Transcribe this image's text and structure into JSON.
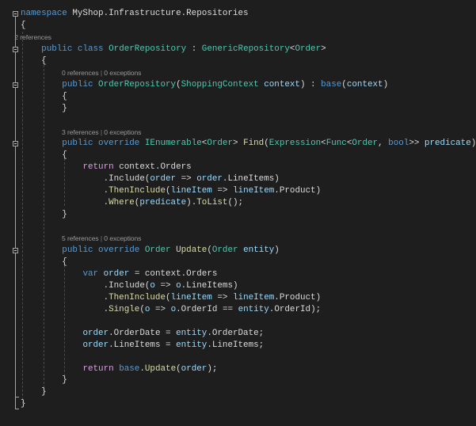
{
  "code": {
    "lines": [
      {
        "tokens": [
          {
            "c": "kw",
            "t": "namespace"
          },
          {
            "c": "df",
            "t": " MyShop.Infrastructure.Repositories"
          }
        ]
      },
      {
        "tokens": [
          {
            "c": "df",
            "t": "{"
          }
        ]
      },
      {
        "lens": true,
        "tokens": [
          {
            "c": "lc",
            "t": "        2 references"
          }
        ]
      },
      {
        "tokens": [
          {
            "c": "df",
            "t": "    "
          },
          {
            "c": "kw",
            "t": "public class "
          },
          {
            "c": "ty",
            "t": "OrderRepository"
          },
          {
            "c": "df",
            "t": " : "
          },
          {
            "c": "ty",
            "t": "GenericRepository"
          },
          {
            "c": "df",
            "t": "<"
          },
          {
            "c": "ty",
            "t": "Order"
          },
          {
            "c": "df",
            "t": ">"
          }
        ]
      },
      {
        "tokens": [
          {
            "c": "df",
            "t": "    {"
          }
        ]
      },
      {
        "lens": true,
        "tokens": [
          {
            "c": "lc",
            "t": "0 references"
          },
          {
            "c": "sep",
            "t": " | "
          },
          {
            "c": "lc",
            "t": "0 exceptions"
          }
        ],
        "indent": 2
      },
      {
        "tokens": [
          {
            "c": "df",
            "t": "        "
          },
          {
            "c": "kw",
            "t": "public "
          },
          {
            "c": "ty",
            "t": "OrderRepository"
          },
          {
            "c": "df",
            "t": "("
          },
          {
            "c": "ty",
            "t": "ShoppingContext"
          },
          {
            "c": "pm",
            "t": " context"
          },
          {
            "c": "df",
            "t": ") : "
          },
          {
            "c": "kw",
            "t": "base"
          },
          {
            "c": "df",
            "t": "("
          },
          {
            "c": "pm",
            "t": "context"
          },
          {
            "c": "df",
            "t": ")"
          }
        ]
      },
      {
        "tokens": [
          {
            "c": "df",
            "t": "        {"
          }
        ]
      },
      {
        "tokens": [
          {
            "c": "df",
            "t": "        }"
          }
        ]
      },
      {
        "tokens": []
      },
      {
        "lens": true,
        "tokens": [
          {
            "c": "lc",
            "t": "3 references"
          },
          {
            "c": "sep",
            "t": " | "
          },
          {
            "c": "lc",
            "t": "0 exceptions"
          }
        ],
        "indent": 2
      },
      {
        "tokens": [
          {
            "c": "df",
            "t": "        "
          },
          {
            "c": "kw",
            "t": "public override "
          },
          {
            "c": "ty",
            "t": "IEnumerable"
          },
          {
            "c": "df",
            "t": "<"
          },
          {
            "c": "ty",
            "t": "Order"
          },
          {
            "c": "df",
            "t": "> "
          },
          {
            "c": "fn",
            "t": "Find"
          },
          {
            "c": "df",
            "t": "("
          },
          {
            "c": "ty",
            "t": "Expression"
          },
          {
            "c": "df",
            "t": "<"
          },
          {
            "c": "ty",
            "t": "Func"
          },
          {
            "c": "df",
            "t": "<"
          },
          {
            "c": "ty",
            "t": "Order"
          },
          {
            "c": "df",
            "t": ", "
          },
          {
            "c": "kw",
            "t": "bool"
          },
          {
            "c": "df",
            "t": ">> "
          },
          {
            "c": "pm",
            "t": "predicate"
          },
          {
            "c": "df",
            "t": ")"
          }
        ]
      },
      {
        "tokens": [
          {
            "c": "df",
            "t": "        {"
          }
        ]
      },
      {
        "tokens": [
          {
            "c": "df",
            "t": "            "
          },
          {
            "c": "ctl",
            "t": "return"
          },
          {
            "c": "df",
            "t": " context.Orders"
          }
        ]
      },
      {
        "tokens": [
          {
            "c": "df",
            "t": "                .Include("
          },
          {
            "c": "pm",
            "t": "order"
          },
          {
            "c": "df",
            "t": " => "
          },
          {
            "c": "pm",
            "t": "order"
          },
          {
            "c": "df",
            "t": ".LineItems)"
          }
        ]
      },
      {
        "tokens": [
          {
            "c": "df",
            "t": "                ."
          },
          {
            "c": "fn",
            "t": "ThenInclude"
          },
          {
            "c": "df",
            "t": "("
          },
          {
            "c": "pm",
            "t": "lineItem"
          },
          {
            "c": "df",
            "t": " => "
          },
          {
            "c": "pm",
            "t": "lineItem"
          },
          {
            "c": "df",
            "t": ".Product)"
          }
        ]
      },
      {
        "tokens": [
          {
            "c": "df",
            "t": "                ."
          },
          {
            "c": "fn",
            "t": "Where"
          },
          {
            "c": "df",
            "t": "("
          },
          {
            "c": "pm",
            "t": "predicate"
          },
          {
            "c": "df",
            "t": ")."
          },
          {
            "c": "fn",
            "t": "ToList"
          },
          {
            "c": "df",
            "t": "();"
          }
        ]
      },
      {
        "tokens": [
          {
            "c": "df",
            "t": "        }"
          }
        ]
      },
      {
        "tokens": []
      },
      {
        "lens": true,
        "tokens": [
          {
            "c": "lc",
            "t": "5 references"
          },
          {
            "c": "sep",
            "t": " | "
          },
          {
            "c": "lc",
            "t": "0 exceptions"
          }
        ],
        "indent": 2
      },
      {
        "tokens": [
          {
            "c": "df",
            "t": "        "
          },
          {
            "c": "kw",
            "t": "public override "
          },
          {
            "c": "ty",
            "t": "Order "
          },
          {
            "c": "fn",
            "t": "Update"
          },
          {
            "c": "df",
            "t": "("
          },
          {
            "c": "ty",
            "t": "Order"
          },
          {
            "c": "pm",
            "t": " entity"
          },
          {
            "c": "df",
            "t": ")"
          }
        ]
      },
      {
        "tokens": [
          {
            "c": "df",
            "t": "        {"
          }
        ]
      },
      {
        "tokens": [
          {
            "c": "df",
            "t": "            "
          },
          {
            "c": "kw",
            "t": "var "
          },
          {
            "c": "pm",
            "t": "order"
          },
          {
            "c": "df",
            "t": " = context.Orders"
          }
        ]
      },
      {
        "tokens": [
          {
            "c": "df",
            "t": "                .Include("
          },
          {
            "c": "pm",
            "t": "o"
          },
          {
            "c": "df",
            "t": " => "
          },
          {
            "c": "pm",
            "t": "o"
          },
          {
            "c": "df",
            "t": ".LineItems)"
          }
        ]
      },
      {
        "tokens": [
          {
            "c": "df",
            "t": "                ."
          },
          {
            "c": "fn",
            "t": "ThenInclude"
          },
          {
            "c": "df",
            "t": "("
          },
          {
            "c": "pm",
            "t": "lineItem"
          },
          {
            "c": "df",
            "t": " => "
          },
          {
            "c": "pm",
            "t": "lineItem"
          },
          {
            "c": "df",
            "t": ".Product)"
          }
        ]
      },
      {
        "tokens": [
          {
            "c": "df",
            "t": "                ."
          },
          {
            "c": "fn",
            "t": "Single"
          },
          {
            "c": "df",
            "t": "("
          },
          {
            "c": "pm",
            "t": "o"
          },
          {
            "c": "df",
            "t": " => "
          },
          {
            "c": "pm",
            "t": "o"
          },
          {
            "c": "df",
            "t": ".OrderId == "
          },
          {
            "c": "pm",
            "t": "entity"
          },
          {
            "c": "df",
            "t": ".OrderId);"
          }
        ]
      },
      {
        "tokens": []
      },
      {
        "tokens": [
          {
            "c": "df",
            "t": "            "
          },
          {
            "c": "pm",
            "t": "order"
          },
          {
            "c": "df",
            "t": ".OrderDate = "
          },
          {
            "c": "pm",
            "t": "entity"
          },
          {
            "c": "df",
            "t": ".OrderDate;"
          }
        ]
      },
      {
        "tokens": [
          {
            "c": "df",
            "t": "            "
          },
          {
            "c": "pm",
            "t": "order"
          },
          {
            "c": "df",
            "t": ".LineItems = "
          },
          {
            "c": "pm",
            "t": "entity"
          },
          {
            "c": "df",
            "t": ".LineItems;"
          }
        ]
      },
      {
        "tokens": []
      },
      {
        "tokens": [
          {
            "c": "df",
            "t": "            "
          },
          {
            "c": "ctl",
            "t": "return "
          },
          {
            "c": "kw",
            "t": "base"
          },
          {
            "c": "df",
            "t": "."
          },
          {
            "c": "fn",
            "t": "Update"
          },
          {
            "c": "df",
            "t": "("
          },
          {
            "c": "pm",
            "t": "order"
          },
          {
            "c": "df",
            "t": ");"
          }
        ]
      },
      {
        "tokens": [
          {
            "c": "df",
            "t": "        }"
          }
        ]
      },
      {
        "tokens": [
          {
            "c": "df",
            "t": "    }"
          }
        ]
      },
      {
        "tokens": [
          {
            "c": "df",
            "t": "}"
          }
        ]
      }
    ]
  }
}
